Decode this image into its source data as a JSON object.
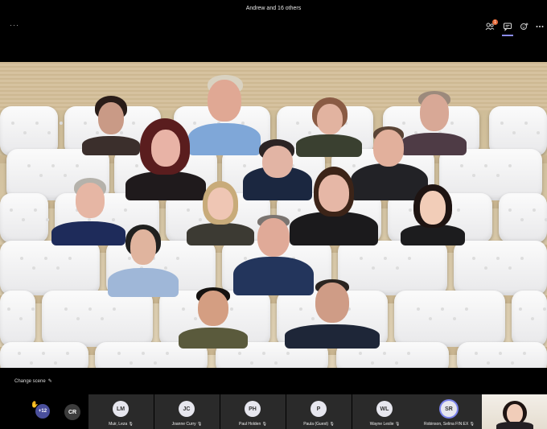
{
  "window": {
    "title": "Andrew and 16 others"
  },
  "toolbar": {
    "more_left": "···",
    "participants_badge": "1"
  },
  "scene": {
    "change_scene_label": "Change scene"
  },
  "strip": {
    "overflow_count": "+12",
    "cr_initials": "CR",
    "participants": [
      {
        "initials": "LM",
        "name": "Muir, Leza"
      },
      {
        "initials": "JC",
        "name": "Joanne Curry"
      },
      {
        "initials": "PH",
        "name": "Paul Holden"
      },
      {
        "initials": "P",
        "name": "Paula (Guest)"
      },
      {
        "initials": "WL",
        "name": "Wayne Leslie"
      },
      {
        "initials": "SR",
        "name": "Robinson, Selina FIN:EX"
      }
    ]
  },
  "colors": {
    "accent": "#7b83eb",
    "badge": "#e46b3b"
  }
}
